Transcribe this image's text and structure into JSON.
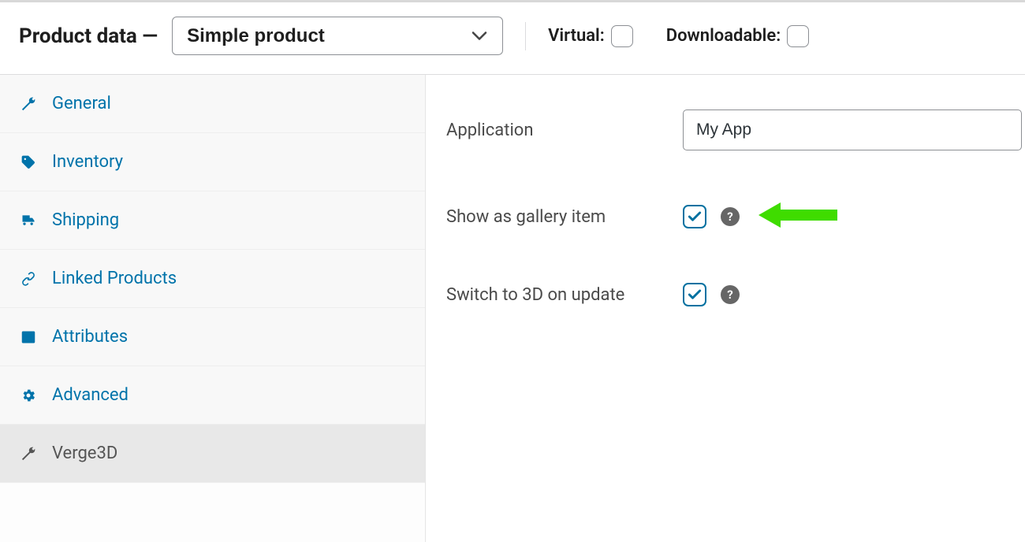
{
  "header": {
    "title": "Product data —",
    "product_type": "Simple product",
    "virtual_label": "Virtual:",
    "virtual_checked": false,
    "downloadable_label": "Downloadable:",
    "downloadable_checked": false
  },
  "sidebar": {
    "tabs": [
      {
        "id": "general",
        "label": "General",
        "icon": "wrench"
      },
      {
        "id": "inventory",
        "label": "Inventory",
        "icon": "tag"
      },
      {
        "id": "shipping",
        "label": "Shipping",
        "icon": "truck"
      },
      {
        "id": "linked",
        "label": "Linked Products",
        "icon": "link"
      },
      {
        "id": "attrs",
        "label": "Attributes",
        "icon": "layout"
      },
      {
        "id": "advanced",
        "label": "Advanced",
        "icon": "gear"
      },
      {
        "id": "verge3d",
        "label": "Verge3D",
        "icon": "wrench",
        "active": true
      }
    ]
  },
  "panel": {
    "application_label": "Application",
    "application_value": "My App",
    "gallery_label": "Show as gallery item",
    "gallery_checked": true,
    "switch3d_label": "Switch to 3D on update",
    "switch3d_checked": true
  },
  "colors": {
    "link": "#0073aa",
    "border": "#8c8f94",
    "arrow": "#39e600"
  }
}
